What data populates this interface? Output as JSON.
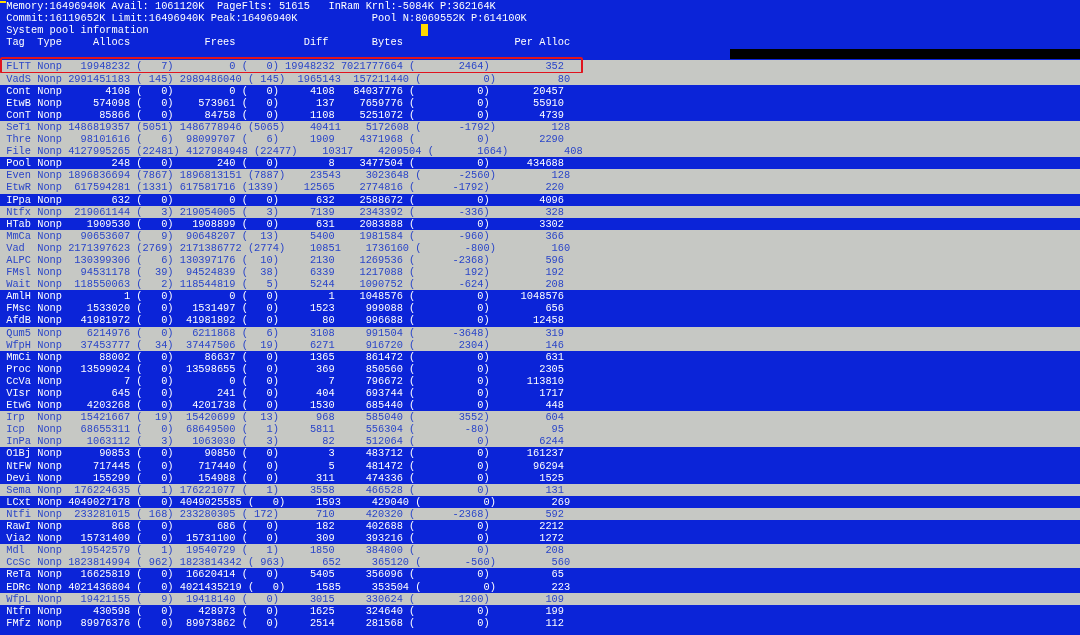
{
  "status_lines": [
    "Memory:16496940K Avail: 1061120K  PageFlts: 51615   InRam Krnl:-5084K P:362164K",
    "Commit:16119652K Limit:16496940K Peak:16496940K            Pool N:8069552K P:614100K",
    "System pool information"
  ],
  "columns": [
    "Tag",
    "Type",
    "Allocs",
    "Frees",
    "Diff",
    "Bytes",
    "Per Alloc"
  ],
  "rows": [
    {
      "tag": "FLTT",
      "type": "Nonp",
      "allocs": "19948232",
      "allocs_delta": "(   7)",
      "frees": "0",
      "frees_delta": "(   0)",
      "diff": "19948232",
      "bytes": "7021777664",
      "bytes_delta": "(       2464)",
      "per_alloc": "352",
      "highlighted": true,
      "boxed": true
    },
    {
      "tag": "VadS",
      "type": "Nonp",
      "allocs": "2991451183",
      "allocs_delta": "( 145)",
      "frees": "2989486040",
      "frees_delta": "( 145)",
      "diff": "1965143",
      "bytes": "157211440",
      "bytes_delta": "(          0)",
      "per_alloc": "80",
      "highlighted": true,
      "boxed": false
    },
    {
      "tag": "Cont",
      "type": "Nonp",
      "allocs": "4108",
      "allocs_delta": "(   0)",
      "frees": "0",
      "frees_delta": "(   0)",
      "diff": "4108",
      "bytes": "84037776",
      "bytes_delta": "(          0)",
      "per_alloc": "20457",
      "highlighted": false,
      "boxed": false
    },
    {
      "tag": "EtwB",
      "type": "Nonp",
      "allocs": "574098",
      "allocs_delta": "(   0)",
      "frees": "573961",
      "frees_delta": "(   0)",
      "diff": "137",
      "bytes": "7659776",
      "bytes_delta": "(          0)",
      "per_alloc": "55910",
      "highlighted": false,
      "boxed": false
    },
    {
      "tag": "ConT",
      "type": "Nonp",
      "allocs": "85866",
      "allocs_delta": "(   0)",
      "frees": "84758",
      "frees_delta": "(   0)",
      "diff": "1108",
      "bytes": "5251072",
      "bytes_delta": "(          0)",
      "per_alloc": "4739",
      "highlighted": false,
      "boxed": false
    },
    {
      "tag": "SeT1",
      "type": "Nonp",
      "allocs": "1486819357",
      "allocs_delta": "(5051)",
      "frees": "1486778946",
      "frees_delta": "(5065)",
      "diff": "40411",
      "bytes": "5172608",
      "bytes_delta": "(      -1792)",
      "per_alloc": "128",
      "highlighted": true,
      "boxed": false
    },
    {
      "tag": "Thre",
      "type": "Nonp",
      "allocs": "98101616",
      "allocs_delta": "(   6)",
      "frees": "98099707",
      "frees_delta": "(   6)",
      "diff": "1909",
      "bytes": "4371968",
      "bytes_delta": "(          0)",
      "per_alloc": "2290",
      "highlighted": true,
      "boxed": false
    },
    {
      "tag": "File",
      "type": "Nonp",
      "allocs": "4127995265",
      "allocs_delta": "(22481)",
      "frees": "4127984948",
      "frees_delta": "(22477)",
      "diff": "10317",
      "bytes": "4209504",
      "bytes_delta": "(       1664)",
      "per_alloc": "408",
      "highlighted": true,
      "boxed": false
    },
    {
      "tag": "Pool",
      "type": "Nonp",
      "allocs": "248",
      "allocs_delta": "(   0)",
      "frees": "240",
      "frees_delta": "(   0)",
      "diff": "8",
      "bytes": "3477504",
      "bytes_delta": "(          0)",
      "per_alloc": "434688",
      "highlighted": false,
      "boxed": false
    },
    {
      "tag": "Even",
      "type": "Nonp",
      "allocs": "1896836694",
      "allocs_delta": "(7867)",
      "frees": "1896813151",
      "frees_delta": "(7887)",
      "diff": "23543",
      "bytes": "3023648",
      "bytes_delta": "(      -2560)",
      "per_alloc": "128",
      "highlighted": true,
      "boxed": false
    },
    {
      "tag": "EtwR",
      "type": "Nonp",
      "allocs": "617594281",
      "allocs_delta": "(1331)",
      "frees": "617581716",
      "frees_delta": "(1339)",
      "diff": "12565",
      "bytes": "2774816",
      "bytes_delta": "(      -1792)",
      "per_alloc": "220",
      "highlighted": true,
      "boxed": false
    },
    {
      "tag": "IPpa",
      "type": "Nonp",
      "allocs": "632",
      "allocs_delta": "(   0)",
      "frees": "0",
      "frees_delta": "(   0)",
      "diff": "632",
      "bytes": "2588672",
      "bytes_delta": "(          0)",
      "per_alloc": "4096",
      "highlighted": false,
      "boxed": false
    },
    {
      "tag": "Ntfx",
      "type": "Nonp",
      "allocs": "219061144",
      "allocs_delta": "(   3)",
      "frees": "219054005",
      "frees_delta": "(   3)",
      "diff": "7139",
      "bytes": "2343392",
      "bytes_delta": "(       -336)",
      "per_alloc": "328",
      "highlighted": true,
      "boxed": false
    },
    {
      "tag": "HTab",
      "type": "Nonp",
      "allocs": "1909530",
      "allocs_delta": "(   0)",
      "frees": "1908899",
      "frees_delta": "(   0)",
      "diff": "631",
      "bytes": "2083888",
      "bytes_delta": "(          0)",
      "per_alloc": "3302",
      "highlighted": false,
      "boxed": false
    },
    {
      "tag": "MmCa",
      "type": "Nonp",
      "allocs": "90653607",
      "allocs_delta": "(   9)",
      "frees": "90648207",
      "frees_delta": "(  13)",
      "diff": "5400",
      "bytes": "1981584",
      "bytes_delta": "(       -960)",
      "per_alloc": "366",
      "highlighted": true,
      "boxed": false
    },
    {
      "tag": "Vad",
      "type": "Nonp",
      "allocs": "2171397623",
      "allocs_delta": "(2769)",
      "frees": "2171386772",
      "frees_delta": "(2774)",
      "diff": "10851",
      "bytes": "1736160",
      "bytes_delta": "(       -800)",
      "per_alloc": "160",
      "highlighted": true,
      "boxed": false
    },
    {
      "tag": "ALPC",
      "type": "Nonp",
      "allocs": "130399306",
      "allocs_delta": "(   6)",
      "frees": "130397176",
      "frees_delta": "(  10)",
      "diff": "2130",
      "bytes": "1269536",
      "bytes_delta": "(      -2368)",
      "per_alloc": "596",
      "highlighted": true,
      "boxed": false
    },
    {
      "tag": "FMsl",
      "type": "Nonp",
      "allocs": "94531178",
      "allocs_delta": "(  39)",
      "frees": "94524839",
      "frees_delta": "(  38)",
      "diff": "6339",
      "bytes": "1217088",
      "bytes_delta": "(        192)",
      "per_alloc": "192",
      "highlighted": true,
      "boxed": false
    },
    {
      "tag": "Wait",
      "type": "Nonp",
      "allocs": "118550063",
      "allocs_delta": "(   2)",
      "frees": "118544819",
      "frees_delta": "(   5)",
      "diff": "5244",
      "bytes": "1090752",
      "bytes_delta": "(       -624)",
      "per_alloc": "208",
      "highlighted": true,
      "boxed": false
    },
    {
      "tag": "AmlH",
      "type": "Nonp",
      "allocs": "1",
      "allocs_delta": "(   0)",
      "frees": "0",
      "frees_delta": "(   0)",
      "diff": "1",
      "bytes": "1048576",
      "bytes_delta": "(          0)",
      "per_alloc": "1048576",
      "highlighted": false,
      "boxed": false
    },
    {
      "tag": "FMsc",
      "type": "Nonp",
      "allocs": "1533020",
      "allocs_delta": "(   0)",
      "frees": "1531497",
      "frees_delta": "(   0)",
      "diff": "1523",
      "bytes": "999088",
      "bytes_delta": "(          0)",
      "per_alloc": "656",
      "highlighted": false,
      "boxed": false
    },
    {
      "tag": "AfdB",
      "type": "Nonp",
      "allocs": "41981972",
      "allocs_delta": "(   0)",
      "frees": "41981892",
      "frees_delta": "(   0)",
      "diff": "80",
      "bytes": "996688",
      "bytes_delta": "(          0)",
      "per_alloc": "12458",
      "highlighted": false,
      "boxed": false
    },
    {
      "tag": "Qum5",
      "type": "Nonp",
      "allocs": "6214976",
      "allocs_delta": "(   0)",
      "frees": "6211868",
      "frees_delta": "(   6)",
      "diff": "3108",
      "bytes": "991504",
      "bytes_delta": "(      -3648)",
      "per_alloc": "319",
      "highlighted": true,
      "boxed": false
    },
    {
      "tag": "WfpH",
      "type": "Nonp",
      "allocs": "37453777",
      "allocs_delta": "(  34)",
      "frees": "37447506",
      "frees_delta": "(  19)",
      "diff": "6271",
      "bytes": "916720",
      "bytes_delta": "(       2304)",
      "per_alloc": "146",
      "highlighted": true,
      "boxed": false
    },
    {
      "tag": "MmCi",
      "type": "Nonp",
      "allocs": "88002",
      "allocs_delta": "(   0)",
      "frees": "86637",
      "frees_delta": "(   0)",
      "diff": "1365",
      "bytes": "861472",
      "bytes_delta": "(          0)",
      "per_alloc": "631",
      "highlighted": false,
      "boxed": false
    },
    {
      "tag": "Proc",
      "type": "Nonp",
      "allocs": "13599024",
      "allocs_delta": "(   0)",
      "frees": "13598655",
      "frees_delta": "(   0)",
      "diff": "369",
      "bytes": "850560",
      "bytes_delta": "(          0)",
      "per_alloc": "2305",
      "highlighted": false,
      "boxed": false
    },
    {
      "tag": "CcVa",
      "type": "Nonp",
      "allocs": "7",
      "allocs_delta": "(   0)",
      "frees": "0",
      "frees_delta": "(   0)",
      "diff": "7",
      "bytes": "796672",
      "bytes_delta": "(          0)",
      "per_alloc": "113810",
      "highlighted": false,
      "boxed": false
    },
    {
      "tag": "VIsr",
      "type": "Nonp",
      "allocs": "645",
      "allocs_delta": "(   0)",
      "frees": "241",
      "frees_delta": "(   0)",
      "diff": "404",
      "bytes": "693744",
      "bytes_delta": "(          0)",
      "per_alloc": "1717",
      "highlighted": false,
      "boxed": false
    },
    {
      "tag": "EtwG",
      "type": "Nonp",
      "allocs": "4203268",
      "allocs_delta": "(   0)",
      "frees": "4201738",
      "frees_delta": "(   0)",
      "diff": "1530",
      "bytes": "685440",
      "bytes_delta": "(          0)",
      "per_alloc": "448",
      "highlighted": false,
      "boxed": false
    },
    {
      "tag": "Irp",
      "type": "Nonp",
      "allocs": "15421667",
      "allocs_delta": "(  19)",
      "frees": "15420699",
      "frees_delta": "(  13)",
      "diff": "968",
      "bytes": "585040",
      "bytes_delta": "(       3552)",
      "per_alloc": "604",
      "highlighted": true,
      "boxed": false
    },
    {
      "tag": "Icp",
      "type": "Nonp",
      "allocs": "68655311",
      "allocs_delta": "(   0)",
      "frees": "68649500",
      "frees_delta": "(   1)",
      "diff": "5811",
      "bytes": "556304",
      "bytes_delta": "(        -80)",
      "per_alloc": "95",
      "highlighted": true,
      "boxed": false
    },
    {
      "tag": "InPa",
      "type": "Nonp",
      "allocs": "1063112",
      "allocs_delta": "(   3)",
      "frees": "1063030",
      "frees_delta": "(   3)",
      "diff": "82",
      "bytes": "512064",
      "bytes_delta": "(          0)",
      "per_alloc": "6244",
      "highlighted": true,
      "boxed": false
    },
    {
      "tag": "O1Bj",
      "type": "Nonp",
      "allocs": "90853",
      "allocs_delta": "(   0)",
      "frees": "90850",
      "frees_delta": "(   0)",
      "diff": "3",
      "bytes": "483712",
      "bytes_delta": "(          0)",
      "per_alloc": "161237",
      "highlighted": false,
      "boxed": false
    },
    {
      "tag": "NtFW",
      "type": "Nonp",
      "allocs": "717445",
      "allocs_delta": "(   0)",
      "frees": "717440",
      "frees_delta": "(   0)",
      "diff": "5",
      "bytes": "481472",
      "bytes_delta": "(          0)",
      "per_alloc": "96294",
      "highlighted": false,
      "boxed": false
    },
    {
      "tag": "Devi",
      "type": "Nonp",
      "allocs": "155299",
      "allocs_delta": "(   0)",
      "frees": "154988",
      "frees_delta": "(   0)",
      "diff": "311",
      "bytes": "474336",
      "bytes_delta": "(          0)",
      "per_alloc": "1525",
      "highlighted": false,
      "boxed": false
    },
    {
      "tag": "Sema",
      "type": "Nonp",
      "allocs": "176224635",
      "allocs_delta": "(   1)",
      "frees": "176221077",
      "frees_delta": "(   1)",
      "diff": "3558",
      "bytes": "466528",
      "bytes_delta": "(          0)",
      "per_alloc": "131",
      "highlighted": true,
      "boxed": false
    },
    {
      "tag": "LCxt",
      "type": "Nonp",
      "allocs": "4049027178",
      "allocs_delta": "(   0)",
      "frees": "4049025585",
      "frees_delta": "(   0)",
      "diff": "1593",
      "bytes": "429040",
      "bytes_delta": "(          0)",
      "per_alloc": "269",
      "highlighted": false,
      "boxed": false
    },
    {
      "tag": "Ntfi",
      "type": "Nonp",
      "allocs": "233281015",
      "allocs_delta": "( 168)",
      "frees": "233280305",
      "frees_delta": "( 172)",
      "diff": "710",
      "bytes": "420320",
      "bytes_delta": "(      -2368)",
      "per_alloc": "592",
      "highlighted": true,
      "boxed": false
    },
    {
      "tag": "RawI",
      "type": "Nonp",
      "allocs": "868",
      "allocs_delta": "(   0)",
      "frees": "686",
      "frees_delta": "(   0)",
      "diff": "182",
      "bytes": "402688",
      "bytes_delta": "(          0)",
      "per_alloc": "2212",
      "highlighted": false,
      "boxed": false
    },
    {
      "tag": "Via2",
      "type": "Nonp",
      "allocs": "15731409",
      "allocs_delta": "(   0)",
      "frees": "15731100",
      "frees_delta": "(   0)",
      "diff": "309",
      "bytes": "393216",
      "bytes_delta": "(          0)",
      "per_alloc": "1272",
      "highlighted": false,
      "boxed": false
    },
    {
      "tag": "Mdl",
      "type": "Nonp",
      "allocs": "19542579",
      "allocs_delta": "(   1)",
      "frees": "19540729",
      "frees_delta": "(   1)",
      "diff": "1850",
      "bytes": "384800",
      "bytes_delta": "(          0)",
      "per_alloc": "208",
      "highlighted": true,
      "boxed": false
    },
    {
      "tag": "CcSc",
      "type": "Nonp",
      "allocs": "1823814994",
      "allocs_delta": "( 962)",
      "frees": "1823814342",
      "frees_delta": "( 963)",
      "diff": "652",
      "bytes": "365120",
      "bytes_delta": "(       -560)",
      "per_alloc": "560",
      "highlighted": true,
      "boxed": false
    },
    {
      "tag": "ReTa",
      "type": "Nonp",
      "allocs": "16625819",
      "allocs_delta": "(   0)",
      "frees": "16620414",
      "frees_delta": "(   0)",
      "diff": "5405",
      "bytes": "356096",
      "bytes_delta": "(          0)",
      "per_alloc": "65",
      "highlighted": false,
      "boxed": false
    },
    {
      "tag": "EDRc",
      "type": "Nonp",
      "allocs": "4021436804",
      "allocs_delta": "(   0)",
      "frees": "4021435219",
      "frees_delta": "(   0)",
      "diff": "1585",
      "bytes": "353504",
      "bytes_delta": "(          0)",
      "per_alloc": "223",
      "highlighted": false,
      "boxed": false
    },
    {
      "tag": "WfpL",
      "type": "Nonp",
      "allocs": "19421155",
      "allocs_delta": "(   9)",
      "frees": "19418140",
      "frees_delta": "(   0)",
      "diff": "3015",
      "bytes": "330624",
      "bytes_delta": "(       1200)",
      "per_alloc": "109",
      "highlighted": true,
      "boxed": false
    },
    {
      "tag": "Ntfn",
      "type": "Nonp",
      "allocs": "430598",
      "allocs_delta": "(   0)",
      "frees": "428973",
      "frees_delta": "(   0)",
      "diff": "1625",
      "bytes": "324640",
      "bytes_delta": "(          0)",
      "per_alloc": "199",
      "highlighted": false,
      "boxed": false
    },
    {
      "tag": "FMfz",
      "type": "Nonp",
      "allocs": "89976376",
      "allocs_delta": "(   0)",
      "frees": "89973862",
      "frees_delta": "(   0)",
      "diff": "2514",
      "bytes": "281568",
      "bytes_delta": "(          0)",
      "per_alloc": "112",
      "highlighted": false,
      "boxed": false
    }
  ]
}
